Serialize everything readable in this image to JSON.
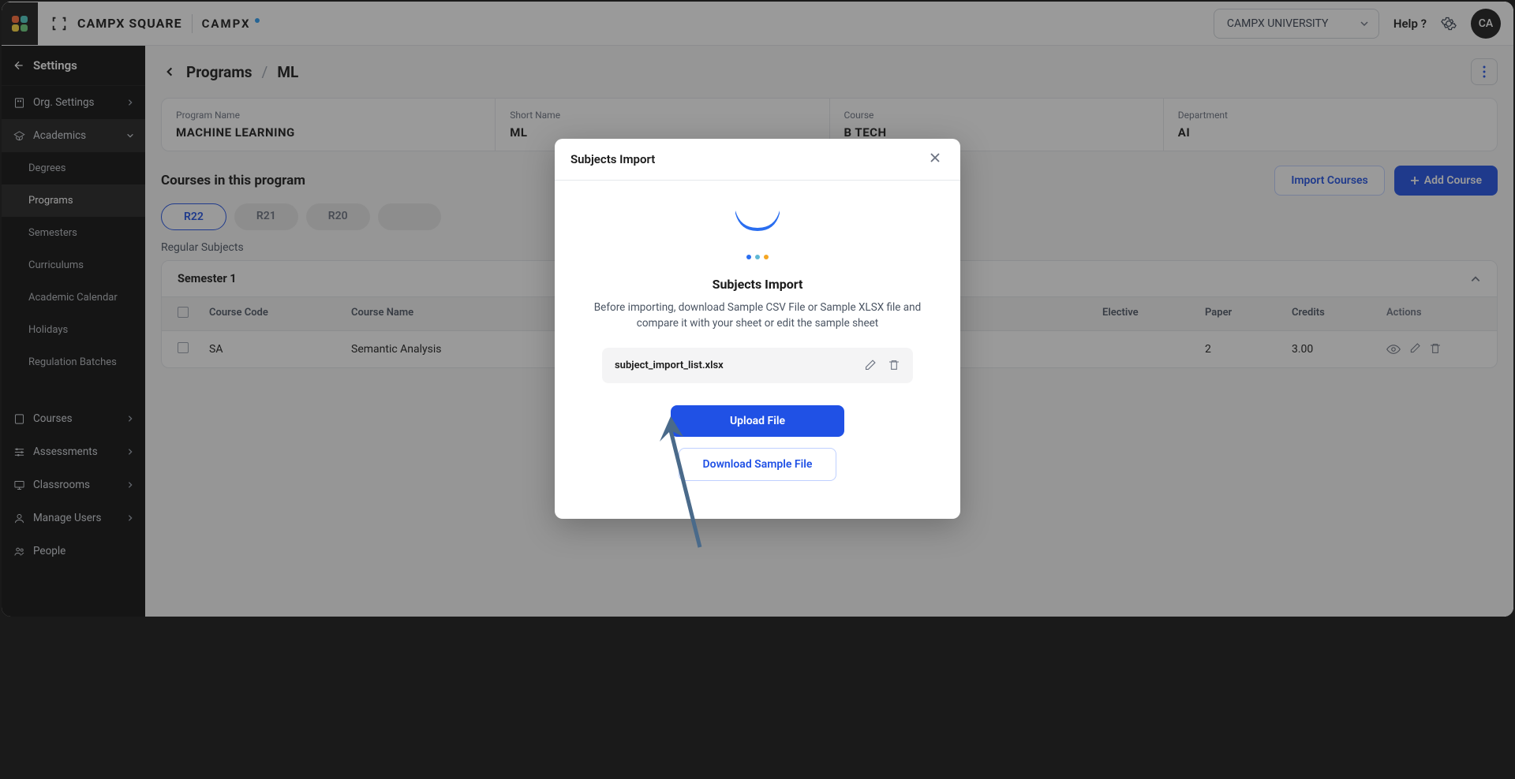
{
  "topbar": {
    "logo_square": "CAMPX SQUARE",
    "logo_campx": "CAMPX",
    "university": "CAMPX UNIVERSITY",
    "help": "Help ?",
    "avatar": "CA"
  },
  "sidebar": {
    "back": "Settings",
    "items": [
      {
        "label": "Org. Settings",
        "icon": "org",
        "chev": true
      },
      {
        "label": "Academics",
        "icon": "academics",
        "chev": true,
        "active": true
      },
      {
        "label": "Courses",
        "icon": "courses",
        "chev": true
      },
      {
        "label": "Assessments",
        "icon": "assessments",
        "chev": true
      },
      {
        "label": "Classrooms",
        "icon": "classrooms",
        "chev": true
      },
      {
        "label": "Manage Users",
        "icon": "users",
        "chev": true
      },
      {
        "label": "People",
        "icon": "people",
        "chev": false
      }
    ],
    "sub_items": [
      "Degrees",
      "Programs",
      "Semesters",
      "Curriculums",
      "Academic Calendar",
      "Holidays",
      "Regulation Batches"
    ],
    "sub_active": "Programs"
  },
  "breadcrumb": {
    "programs": "Programs",
    "current": "ML"
  },
  "info": {
    "program_name_label": "Program Name",
    "program_name": "MACHINE LEARNING",
    "short_name_label": "Short Name",
    "short_name": "ML",
    "course_label": "Course",
    "course": "B TECH",
    "department_label": "Department",
    "department": "AI"
  },
  "section": {
    "title": "Courses in this program",
    "import_btn": "Import Courses",
    "add_btn": "Add Course"
  },
  "tabs": [
    "R22",
    "R21",
    "R20"
  ],
  "tab_active": "R22",
  "regular_label": "Regular Subjects",
  "semester": {
    "title": "Semester 1",
    "columns": [
      "Course Code",
      "Course Name",
      "Elective",
      "Paper",
      "Credits",
      "Actions"
    ],
    "rows": [
      {
        "code": "SA",
        "name": "Semantic Analysis",
        "paper": "2",
        "credits": "3.00"
      }
    ]
  },
  "modal": {
    "title": "Subjects Import",
    "heading": "Subjects Import",
    "description": "Before importing, download Sample CSV File or Sample XLSX file and compare it with your sheet or edit the sample sheet",
    "filename": "subject_import_list.xlsx",
    "upload_btn": "Upload File",
    "download_btn": "Download Sample File"
  }
}
